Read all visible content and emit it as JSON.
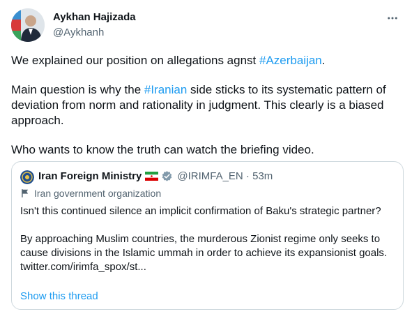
{
  "author": {
    "name": "Aykhan Hajizada",
    "handle": "@Aykhanh"
  },
  "tweet": {
    "p1_before": "We explained our position on allegations agnst ",
    "p1_tag": "#Azerbaijan",
    "p1_after": ".",
    "p2_before": "Main question is why the ",
    "p2_tag": "#Iranian",
    "p2_after": " side sticks to its systematic pattern of deviation from norm and rationality in judgment. This clearly is a biased approach.",
    "p3": "Who wants to know the truth can watch the briefing video."
  },
  "quoted": {
    "name": "Iran Foreign Ministry",
    "handle_time": "@IRIMFA_EN · 53m",
    "org_label": "Iran government organization",
    "p1": "Isn't this continued silence an implicit confirmation of Baku's strategic partner?",
    "p2": "By approaching Muslim countries, the murderous Zionist regime only seeks to cause divisions in the Islamic ummah in order to achieve its expansionist goals. twitter.com/irimfa_spox/st...",
    "show_thread": "Show this thread"
  },
  "colors": {
    "link": "#1d9bf0",
    "text": "#0f1419",
    "muted": "#536471",
    "border": "#cfd9de"
  },
  "icons": {
    "more": "more-horizontal-icon",
    "verified": "verified-badge-icon",
    "flag": "iran-flag-icon",
    "org": "flag-icon"
  }
}
